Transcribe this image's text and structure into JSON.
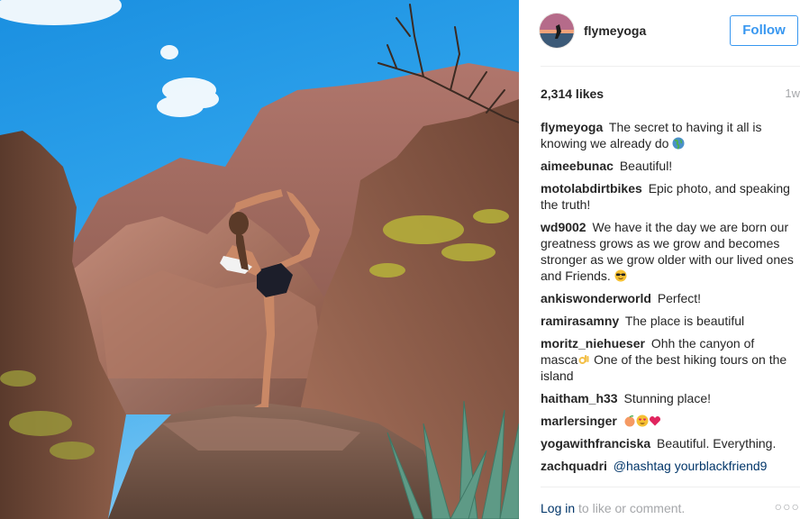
{
  "post": {
    "username": "flymeyoga",
    "follow_label": "Follow",
    "likes": "2,314 likes",
    "time_ago": "1w"
  },
  "comments": [
    {
      "author": "flymeyoga",
      "text": "The secret to having it all is knowing we already do",
      "emoji": "globe"
    },
    {
      "author": "aimeebunac",
      "text": "Beautiful!"
    },
    {
      "author": "motolabdirtbikes",
      "text": "Epic photo, and speaking the truth!"
    },
    {
      "author": "wd9002",
      "text": "We have it the day we are born our greatness grows as we grow and becomes stronger as we grow older with our lived ones and Friends.",
      "emoji": "sunglasses"
    },
    {
      "author": "ankiswonderworld",
      "text": "Perfect!"
    },
    {
      "author": "ramirasamny",
      "text": "The place is beautiful"
    },
    {
      "author": "moritz_niehueser",
      "text_before": "Ohh the canyon of masca",
      "text_after": "One of the best hiking tours on the island",
      "emoji": "ok-hand"
    },
    {
      "author": "haitham_h33",
      "text": "Stunning place!"
    },
    {
      "author": "marlersinger",
      "text": "",
      "emoji": "peach heart-eyes heart"
    },
    {
      "author": "yogawithfranciska",
      "text": "Beautiful. Everything."
    },
    {
      "author": "zachquadri",
      "mention_1": "@hashtag",
      "mention_2": "yourblackfriend9"
    }
  ],
  "footer": {
    "login_label": "Log in",
    "rest_label": "to like or comment.",
    "more_icon": "ellipsis-icon"
  },
  "colors": {
    "accent": "#3897f0",
    "link": "#003569",
    "muted": "#a5a7aa",
    "text": "#262626"
  }
}
